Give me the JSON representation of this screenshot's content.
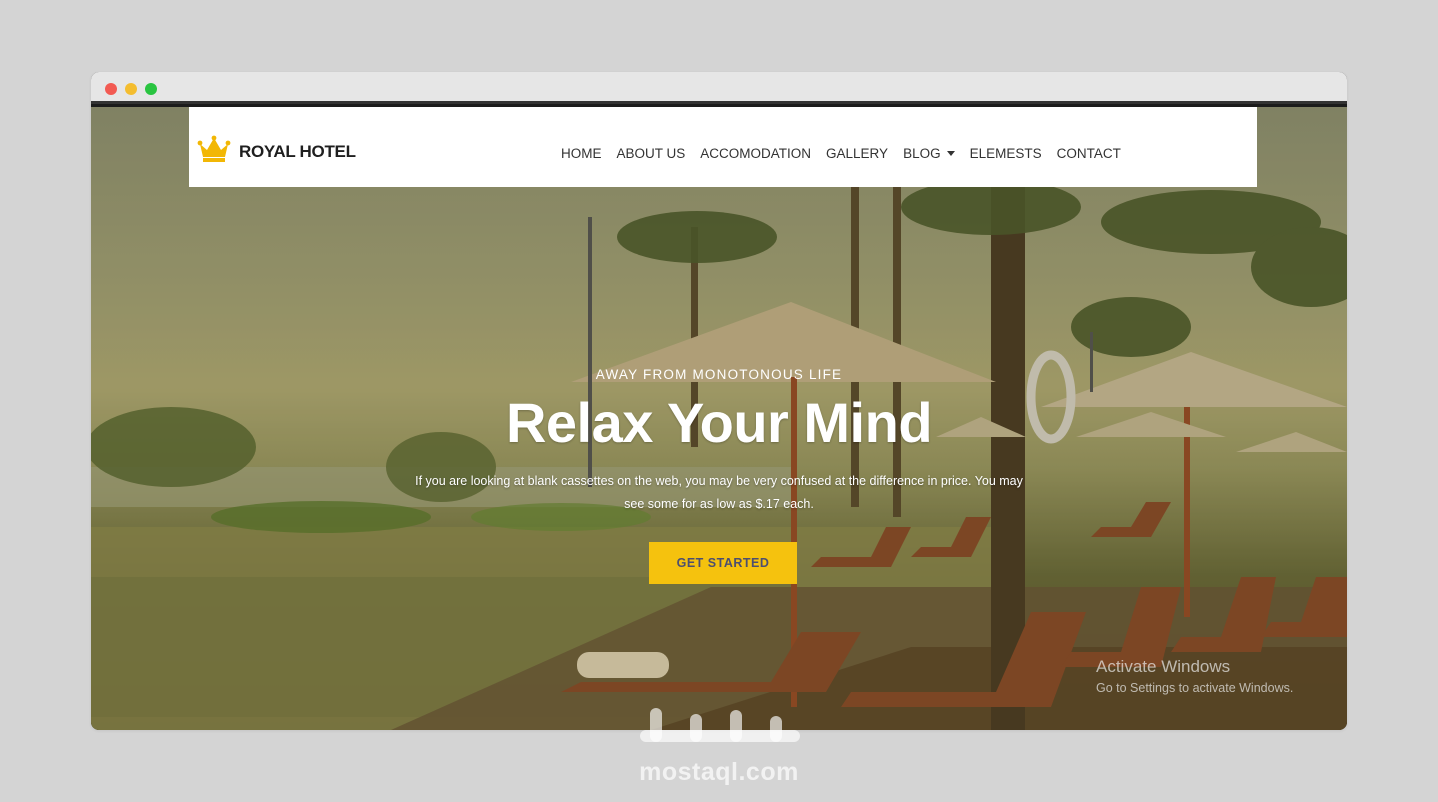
{
  "window": {
    "controls": [
      "close",
      "minimize",
      "maximize"
    ]
  },
  "navbar": {
    "brand": "ROYAL HOTEL",
    "logo_icon": "crown-icon",
    "items": [
      {
        "label": "HOME"
      },
      {
        "label": "ABOUT US"
      },
      {
        "label": "ACCOMODATION"
      },
      {
        "label": "GALLERY"
      },
      {
        "label": "BLOG",
        "dropdown": true
      },
      {
        "label": "ELEMESTS"
      },
      {
        "label": "CONTACT"
      }
    ]
  },
  "hero": {
    "subtitle": "AWAY FROM MONOTONOUS LIFE",
    "title": "Relax Your Mind",
    "description": "If you are looking at blank cassettes on the web, you may be very confused at the difference in price. You may see some for as low as $.17 each.",
    "cta_label": "GET STARTED"
  },
  "os_overlay": {
    "title": "Activate Windows",
    "subtitle": "Go to Settings to activate Windows."
  },
  "watermark": {
    "text": "mostaql.com"
  },
  "colors": {
    "accent": "#f5c20e",
    "crown": "#f2b705",
    "background": "#d4d4d4"
  }
}
